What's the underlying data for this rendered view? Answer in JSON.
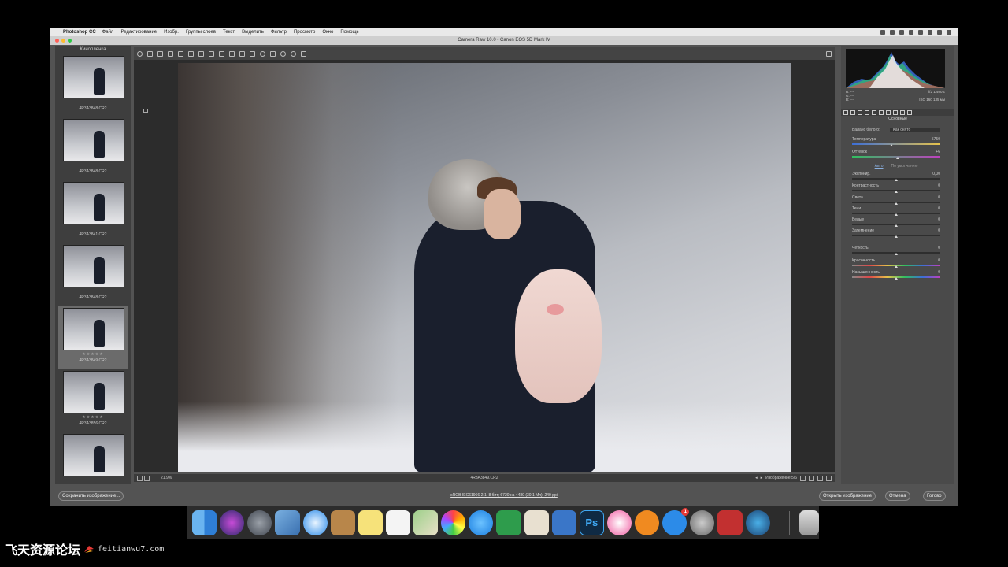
{
  "menubar": {
    "apple": "",
    "app_name": "Photoshop CC",
    "items": [
      "Файл",
      "Редактирование",
      "Изобр.",
      "Группы слоев",
      "Текст",
      "Выделить",
      "Фильтр",
      "Просмотр",
      "Окно",
      "Помощь"
    ]
  },
  "window": {
    "title": "Camera Raw 10.0  -  Canon EOS 5D Mark IV"
  },
  "filmstrip": {
    "header": "Кинопленка",
    "items": [
      {
        "label": "4R3A3848.CR2",
        "stars": ""
      },
      {
        "label": "4R3A3848.CR2",
        "stars": ""
      },
      {
        "label": "4R3A3841.CR2",
        "stars": ""
      },
      {
        "label": "4R3A3848.CR2",
        "stars": ""
      },
      {
        "label": "4R3A3849.CR2",
        "stars": "★★★★★",
        "selected": true
      },
      {
        "label": "4R3A3856.CR2",
        "stars": "★★★★★"
      },
      {
        "label": "",
        "stars": ""
      }
    ]
  },
  "toolbar": {
    "tools": [
      "zoom-icon",
      "hand-icon",
      "white-balance-icon",
      "color-sampler-icon",
      "targeted-adjustment-icon",
      "crop-icon",
      "straighten-icon",
      "transform-icon",
      "spot-removal-icon",
      "red-eye-icon",
      "adjustment-brush-icon",
      "graduated-filter-icon",
      "radial-filter-icon",
      "preferences-icon",
      "rotate-ccw-icon",
      "rotate-cw-icon",
      "trash-icon"
    ]
  },
  "canvas": {
    "filename": "4R3A3849.CR2",
    "zoom": "21.9%",
    "image_count": "Изображение 5/6"
  },
  "histogram": {
    "r": "R: ---",
    "g": "G: ---",
    "b": "B: ---",
    "exposure_info": "f/2   1/400 c",
    "iso_info": "ISO 160   135 мм"
  },
  "panel": {
    "title": "Основные",
    "wb_label": "Баланс белого:",
    "wb_value": "Как снято",
    "temperature": {
      "label": "Температура",
      "value": "5750",
      "pos": 0.45
    },
    "tint": {
      "label": "Оттенок",
      "value": "+6",
      "pos": 0.52
    },
    "auto_label": "Авто",
    "default_label": "По умолчанию",
    "exposure": {
      "label": "Экспонир.",
      "value": "0,00",
      "pos": 0.5
    },
    "contrast": {
      "label": "Контрастность",
      "value": "0",
      "pos": 0.5
    },
    "highlights": {
      "label": "Света",
      "value": "0",
      "pos": 0.5
    },
    "shadows": {
      "label": "Тени",
      "value": "0",
      "pos": 0.5
    },
    "whites": {
      "label": "Белые",
      "value": "0",
      "pos": 0.5
    },
    "blacks": {
      "label": "Затемнение",
      "value": "0",
      "pos": 0.5
    },
    "clarity": {
      "label": "Четкость",
      "value": "0",
      "pos": 0.5
    },
    "vibrance": {
      "label": "Красочность",
      "value": "0",
      "pos": 0.5
    },
    "saturation": {
      "label": "Насыщенность",
      "value": "0",
      "pos": 0.5
    }
  },
  "actions": {
    "save": "Сохранить изображение...",
    "info": "sRGB IEC61966-2.1; 8 бит; 6720 на 4480 (30,1 Мп); 240 ppi",
    "open": "Открыть изображение",
    "cancel": "Отмена",
    "done": "Готово"
  },
  "dock": {
    "icons": [
      "finder-icon",
      "siri-icon",
      "launchpad-icon",
      "image-capture-icon",
      "safari-icon",
      "notes-book-icon",
      "stickies-icon",
      "reminders-icon",
      "maps-icon",
      "photos-icon",
      "messages-icon",
      "numbers-icon",
      "preview-icon",
      "keynote-icon",
      "photoshop-icon",
      "itunes-icon",
      "ibooks-icon",
      "app-store-icon",
      "system-preferences-icon",
      "photo-booth-icon",
      "quicktime-icon",
      "trash-icon"
    ],
    "ps_label": "Ps",
    "app_store_badge": "1"
  },
  "watermark": {
    "cn": "飞天资源论坛",
    "url": "feitianwu7.com"
  },
  "colors": {
    "accent_link": "#8ab0e0",
    "panel_bg": "#4a4a4a",
    "canvas_bg": "#2c2c2c"
  }
}
